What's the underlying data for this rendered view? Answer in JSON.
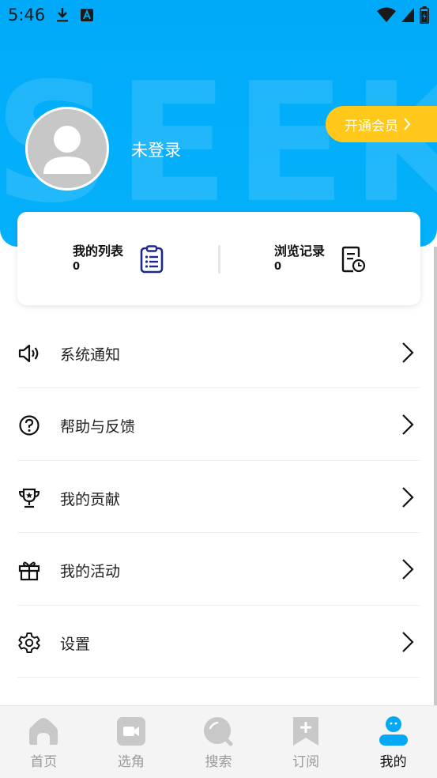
{
  "status_bar": {
    "time": "5:46"
  },
  "header": {
    "watermark": "SEEKER",
    "login_status": "未登录",
    "vip_label": "开通会员"
  },
  "stats": [
    {
      "label": "我的列表",
      "count": "0"
    },
    {
      "label": "浏览记录",
      "count": "0"
    }
  ],
  "menu": [
    {
      "label": "系统通知",
      "icon": "speaker-icon"
    },
    {
      "label": "帮助与反馈",
      "icon": "help-icon"
    },
    {
      "label": "我的贡献",
      "icon": "trophy-icon"
    },
    {
      "label": "我的活动",
      "icon": "gift-icon"
    },
    {
      "label": "设置",
      "icon": "gear-icon"
    }
  ],
  "tabs": [
    {
      "label": "首页",
      "icon": "home-icon",
      "active": false
    },
    {
      "label": "选角",
      "icon": "video-icon",
      "active": false
    },
    {
      "label": "搜索",
      "icon": "search-icon",
      "active": false
    },
    {
      "label": "订阅",
      "icon": "bookmark-icon",
      "active": false
    },
    {
      "label": "我的",
      "icon": "profile-icon",
      "active": true
    }
  ],
  "colors": {
    "accent": "#05b1fb",
    "vip": "#ffc81a",
    "stat_icon": "#1c2a8c"
  }
}
